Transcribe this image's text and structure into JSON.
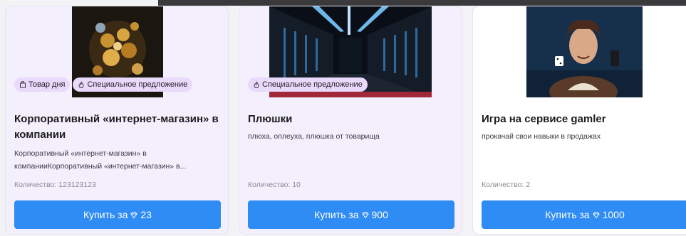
{
  "cards": [
    {
      "badges": [
        "Товар дня",
        "Специальное предложение"
      ],
      "title_line1": "Корпоративный «интернет-магазин» в",
      "title_line2": "компании",
      "desc_line1": "Корпоративный «интернет-магазин» в",
      "desc_line2": "компанииКорпоративный «интернет-магазин» в...",
      "quantity": "Количество: 123123123",
      "buy_label": "Купить за",
      "price": "23"
    },
    {
      "badges": [
        "Специальное предложение"
      ],
      "title": "Плюшки",
      "desc": "плюха, оплеуха, плюшка от товарища",
      "quantity": "Количество: 10",
      "buy_label": "Купить за",
      "price": "900"
    },
    {
      "badges": [],
      "title": "Игра на сервисе gamler",
      "desc": "прокачай свои навыки в продажах",
      "quantity": "Количество: 2",
      "buy_label": "Купить за",
      "price": "1000"
    }
  ],
  "colors": {
    "accent": "#2f8cf5",
    "badge_bg": "#e9d9fb",
    "card_bg": "#f4effd"
  },
  "icons": {
    "product_of_day": "bag-icon",
    "special_offer": "flame-icon",
    "currency": "diamond-icon"
  }
}
